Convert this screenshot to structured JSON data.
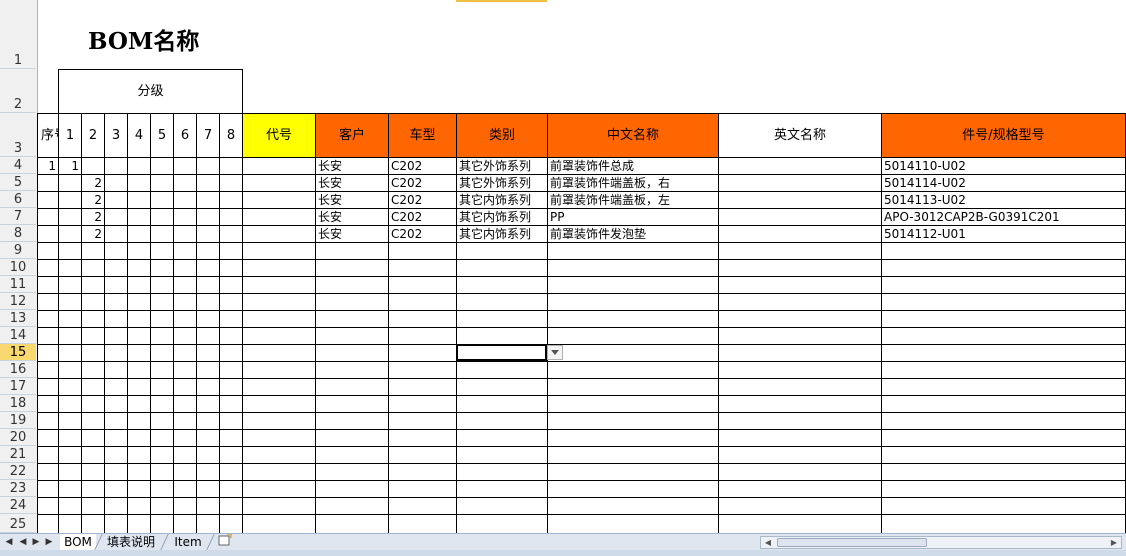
{
  "sheet_title": "BOM名称",
  "row_numbers": [
    "1",
    "2",
    "3",
    "4",
    "5",
    "6",
    "7",
    "8",
    "9",
    "10",
    "11",
    "12",
    "13",
    "14",
    "15",
    "16",
    "17",
    "18",
    "19",
    "20",
    "21",
    "22",
    "23",
    "24",
    "25"
  ],
  "selected_row": "15",
  "header": {
    "level_group": "分级",
    "seq": "序号",
    "levels": [
      "1",
      "2",
      "3",
      "4",
      "5",
      "6",
      "7",
      "8"
    ],
    "code": "代号",
    "customer": "客户",
    "model": "车型",
    "category": "类别",
    "cn_name": "中文名称",
    "en_name": "英文名称",
    "part_no": "件号/规格型号"
  },
  "rows": [
    {
      "seq": "1",
      "l1": "1",
      "l2": "",
      "code": "",
      "customer": "长安",
      "model": "C202",
      "category": "其它外饰系列",
      "cn_name": "前罩装饰件总成",
      "en_name": "",
      "part_no": "5014110-U02"
    },
    {
      "seq": "",
      "l1": "",
      "l2": "2",
      "code": "",
      "customer": "长安",
      "model": "C202",
      "category": "其它外饰系列",
      "cn_name": "前罩装饰件端盖板，右",
      "en_name": "",
      "part_no": "5014114-U02"
    },
    {
      "seq": "",
      "l1": "",
      "l2": "2",
      "code": "",
      "customer": "长安",
      "model": "C202",
      "category": "其它内饰系列",
      "cn_name": "前罩装饰件端盖板，左",
      "en_name": "",
      "part_no": "5014113-U02"
    },
    {
      "seq": "",
      "l1": "",
      "l2": "2",
      "code": "",
      "customer": "长安",
      "model": "C202",
      "category": "其它内饰系列",
      "cn_name": "PP",
      "en_name": "",
      "part_no": "APO-3012CAP2B-G0391C201"
    },
    {
      "seq": "",
      "l1": "",
      "l2": "2",
      "code": "",
      "customer": "长安",
      "model": "C202",
      "category": "其它内饰系列",
      "cn_name": "前罩装饰件发泡垫",
      "en_name": "",
      "part_no": "5014112-U01"
    }
  ],
  "tabs": [
    "BOM",
    "填表说明",
    "Item"
  ],
  "active_tab": "BOM",
  "colors": {
    "orange": "#ff6600",
    "yellow": "#ffff00"
  }
}
